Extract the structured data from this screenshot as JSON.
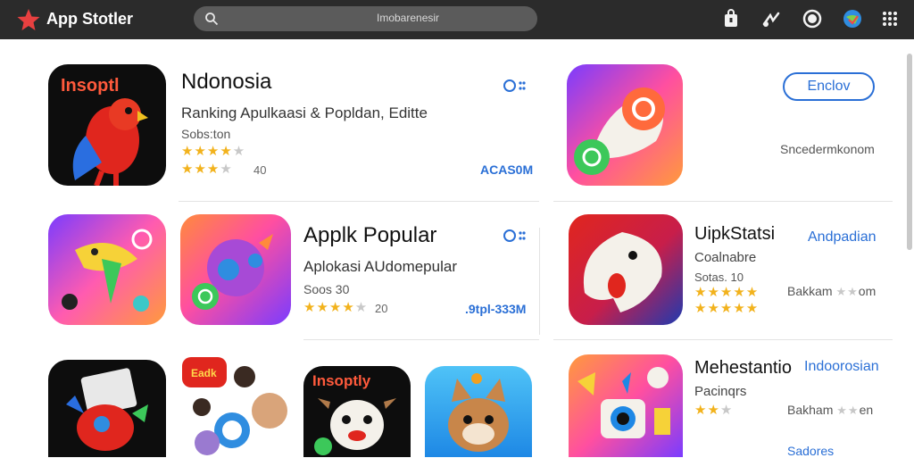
{
  "topbar": {
    "title": "App Stotler",
    "search_text": "Imobarenesir"
  },
  "left": {
    "featured": {
      "name": "Ndonosia",
      "subtitle": "Ranking Apulkaasi & Popldan, Editte",
      "developer": "Sobs:ton",
      "rating": 4,
      "rating_row2": 3,
      "count": "40",
      "price": "ACAS0M",
      "icon_caption": "Insoptl"
    },
    "second": {
      "name": "Applk Popular",
      "subtitle": "Aplokasi AUdomepular",
      "developer": "Soos 30",
      "rating": 4,
      "count": "20",
      "price": ".9tpl-333M"
    },
    "row3_caption": "Insoptly",
    "row3_badge": "Eadk"
  },
  "right": {
    "top_button": "Enclov",
    "top_caption": "Sncedermkonom",
    "app1": {
      "name": "UipkStatsi",
      "link": "Andpadian",
      "category": "Coalnabre",
      "meta": "Sotas. 10",
      "rating": 5,
      "rating_row2": 5,
      "count_label": "Bakkam",
      "count_stars": 2,
      "count_suffix": "om"
    },
    "app2": {
      "name": "Mehestantio",
      "link": "Indoorosian",
      "category": "Pacinqrs",
      "rating": 2,
      "count_label": "Bakham",
      "count_stars": 2,
      "count_suffix": "en",
      "bottom": "Sadores"
    }
  }
}
